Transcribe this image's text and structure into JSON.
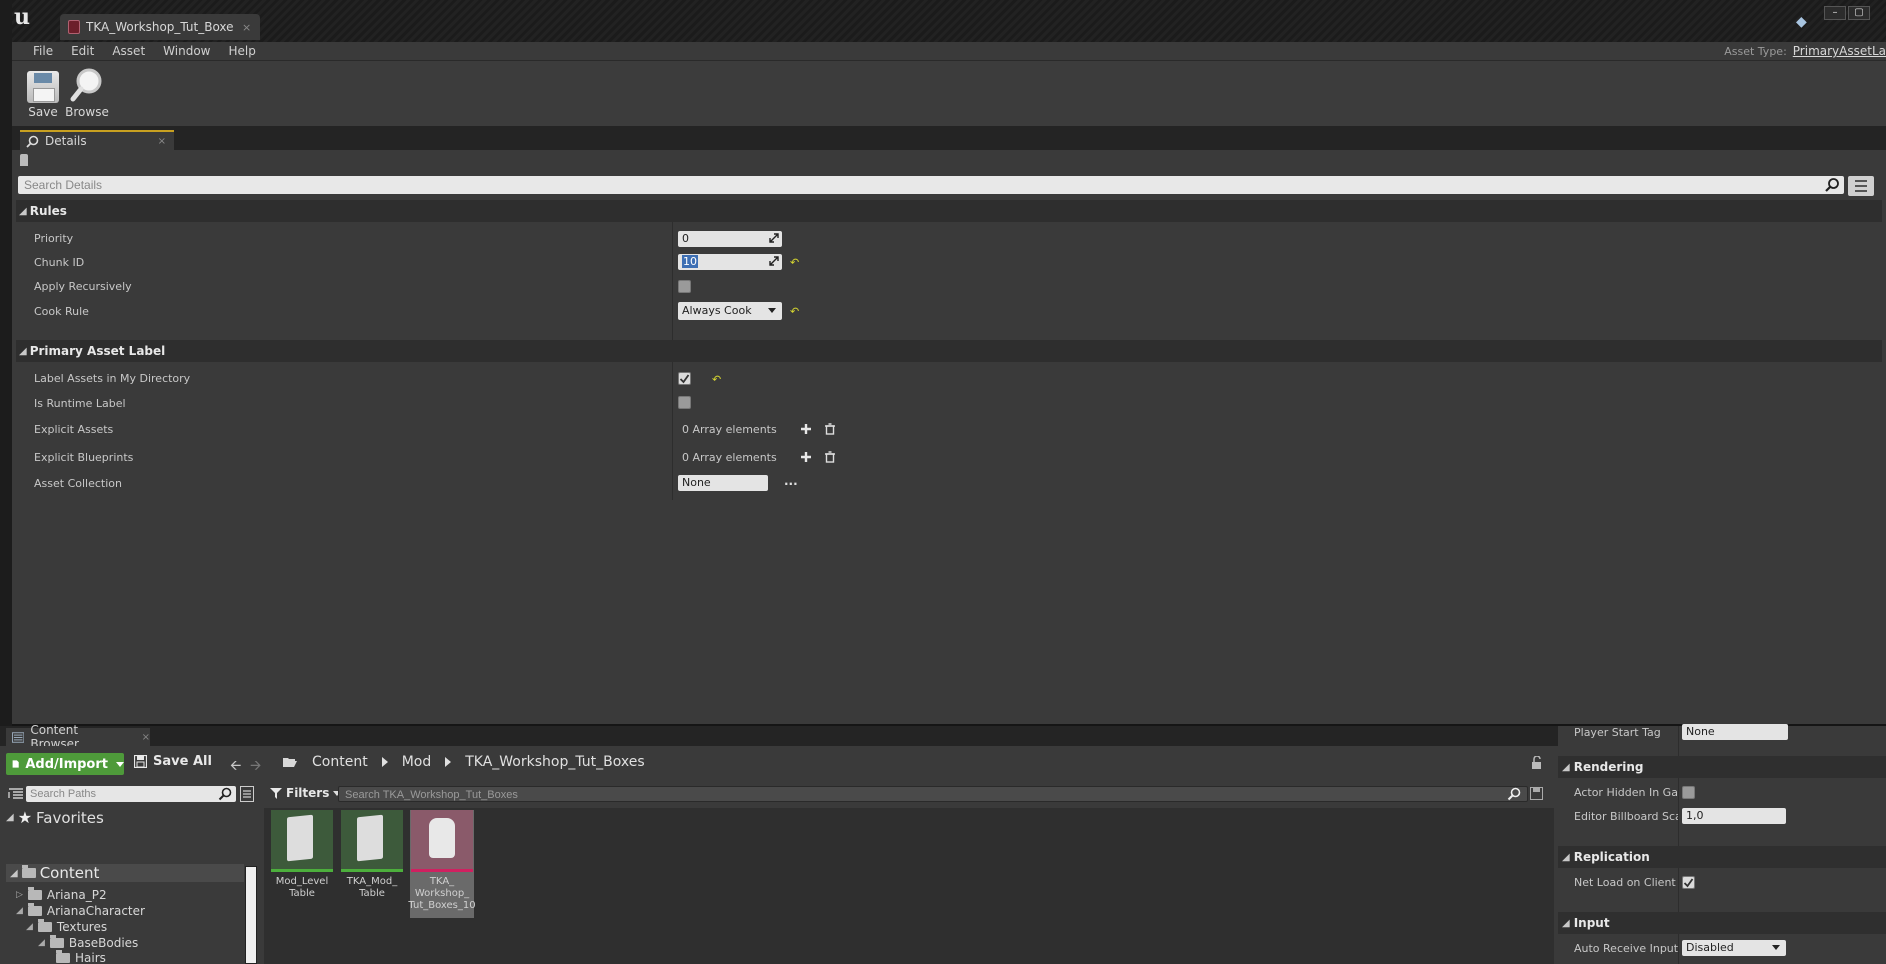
{
  "window": {
    "tab_title": "TKA_Workshop_Tut_Boxe",
    "tab_close": "×",
    "asset_type_label": "Asset Type:",
    "asset_type_value": "PrimaryAssetLa"
  },
  "menu": [
    "File",
    "Edit",
    "Asset",
    "Window",
    "Help"
  ],
  "toolbar": {
    "save_label": "Save",
    "browse_label": "Browse"
  },
  "details": {
    "tab_label": "Details",
    "search_placeholder": "Search Details",
    "categories": {
      "rules": {
        "name": "Rules",
        "priority": {
          "label": "Priority",
          "value": "0"
        },
        "chunk_id": {
          "label": "Chunk ID",
          "value": "10"
        },
        "apply_recursively": {
          "label": "Apply Recursively",
          "checked": false
        },
        "cook_rule": {
          "label": "Cook Rule",
          "value": "Always Cook"
        }
      },
      "primary_asset_label": {
        "name": "Primary Asset Label",
        "label_assets": {
          "label": "Label Assets in My Directory",
          "checked": true
        },
        "is_runtime": {
          "label": "Is Runtime Label",
          "checked": false
        },
        "explicit_assets": {
          "label": "Explicit Assets",
          "value": "0 Array elements"
        },
        "explicit_blueprints": {
          "label": "Explicit Blueprints",
          "value": "0 Array elements"
        },
        "asset_collection": {
          "label": "Asset Collection",
          "value": "None",
          "more": "..."
        }
      }
    }
  },
  "content_browser": {
    "tab_label": "Content Browser",
    "add_import": "Add/Import",
    "save_all": "Save All",
    "breadcrumb": [
      "Content",
      "Mod",
      "TKA_Workshop_Tut_Boxes"
    ],
    "paths_placeholder": "Search Paths",
    "favorites": "Favorites",
    "tree_root": "Content",
    "tree": [
      "Ariana_P2",
      "ArianaCharacter",
      "Textures",
      "BaseBodies",
      "Hairs"
    ],
    "filters_label": "Filters",
    "asset_search_placeholder": "Search TKA_Workshop_Tut_Boxes",
    "assets": [
      {
        "name": "Mod_Level Table"
      },
      {
        "name": "TKA_Mod_ Table"
      },
      {
        "name": "TKA_ Workshop_ Tut_Boxes_10"
      }
    ]
  },
  "level_details": {
    "player_start_tag": {
      "label": "Player Start Tag",
      "value": "None"
    },
    "rendering": "Rendering",
    "actor_hidden": {
      "label": "Actor Hidden In Game",
      "checked": false
    },
    "billboard_scale": {
      "label": "Editor Billboard Scale",
      "value": "1,0"
    },
    "replication": "Replication",
    "net_load": {
      "label": "Net Load on Client",
      "checked": true
    },
    "input": "Input",
    "auto_receive": {
      "label": "Auto Receive Input",
      "value": "Disabled"
    }
  },
  "colors": {
    "accent_green": "#4e9a3a",
    "tab_highlight": "#c8a020",
    "reset_yellow": "#d8d830",
    "label_asset": "#d02060"
  }
}
